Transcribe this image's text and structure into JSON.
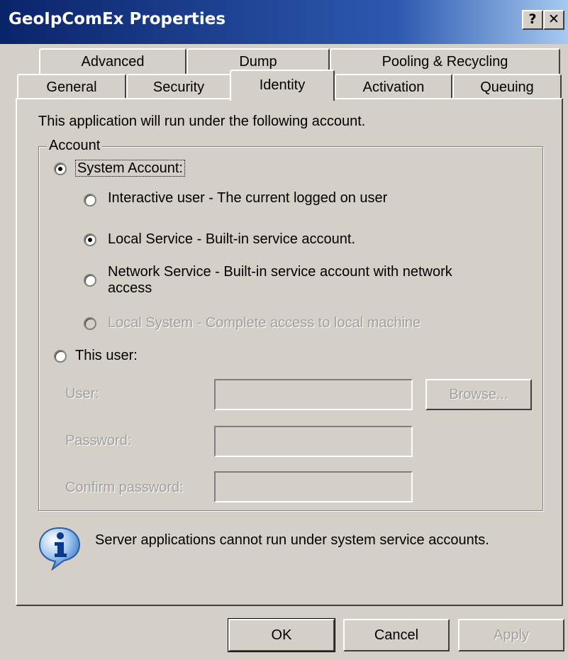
{
  "window": {
    "title": "GeoIpComEx Properties",
    "help": "?",
    "close": "✕"
  },
  "tabs_row_back": [
    "Advanced",
    "Dump",
    "Pooling & Recycling"
  ],
  "tabs_row_front": [
    "General",
    "Security",
    "Identity",
    "Activation",
    "Queuing"
  ],
  "selected_tab": "Identity",
  "identity": {
    "intro": "This application will run under the following account.",
    "group_label": "Account",
    "system_account": {
      "label": "System Account:",
      "selected": true
    },
    "options": [
      {
        "label": "Interactive user - The current logged on user",
        "selected": false,
        "enabled": true
      },
      {
        "label": "Local Service - Built-in service account.",
        "selected": true,
        "enabled": true
      },
      {
        "label": "Network Service - Built-in service account with network access",
        "line1": "Network Service - Built-in service account with network",
        "line2": "access",
        "selected": false,
        "enabled": true
      },
      {
        "label": "Local System - Complete access to local machine",
        "selected": false,
        "enabled": false
      }
    ],
    "this_user": {
      "label": "This user:",
      "selected": false
    },
    "user_label": "User:",
    "password_label": "Password:",
    "confirm_label": "Confirm password:",
    "browse_label": "Browse...",
    "info_text": "Server applications cannot run under system service accounts."
  },
  "buttons": {
    "ok": "OK",
    "cancel": "Cancel",
    "apply": "Apply"
  },
  "colors": {
    "face": "#d4d0c8",
    "title_start": "#0a246a",
    "title_end": "#a6caf0",
    "disabled_text": "#a0a0a0"
  }
}
